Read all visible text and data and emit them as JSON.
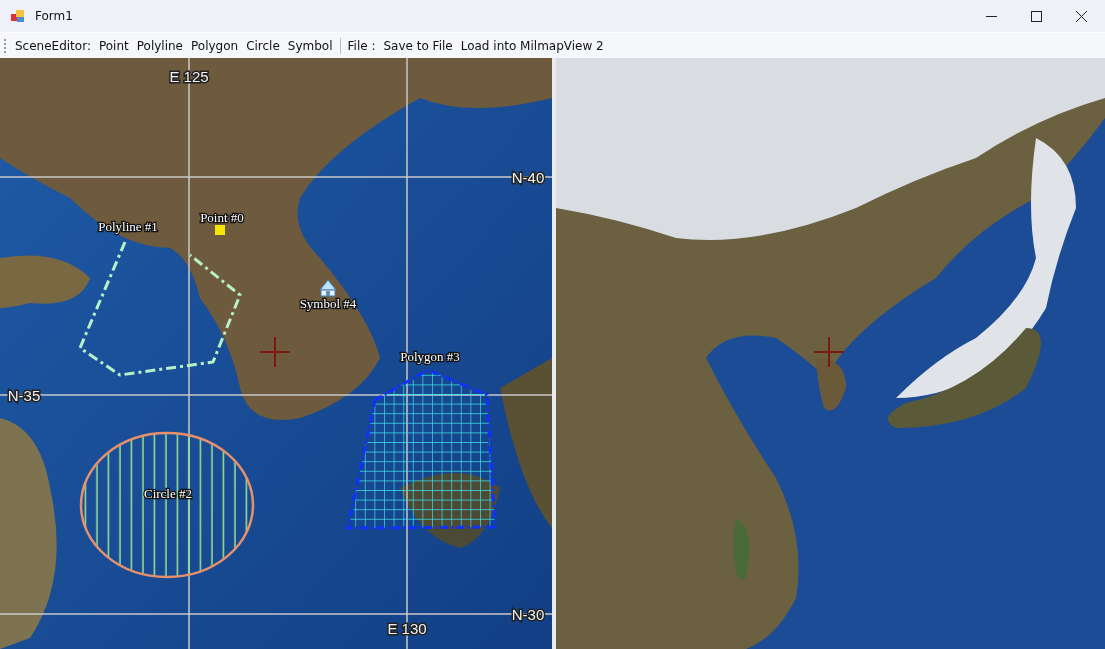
{
  "window": {
    "title": "Form1"
  },
  "toolbar": [
    {
      "kind": "label",
      "text": "SceneEditor:"
    },
    {
      "kind": "button",
      "text": "Point"
    },
    {
      "kind": "button",
      "text": "Polyline"
    },
    {
      "kind": "button",
      "text": "Polygon"
    },
    {
      "kind": "button",
      "text": "Circle"
    },
    {
      "kind": "button",
      "text": "Symbol"
    },
    {
      "kind": "separator"
    },
    {
      "kind": "label",
      "text": "File :"
    },
    {
      "kind": "button",
      "text": "Save to File"
    },
    {
      "kind": "button",
      "text": "Load into MilmapView 2"
    }
  ],
  "left_map": {
    "grid_labels": [
      {
        "text": "E 125"
      },
      {
        "text": "N-40"
      },
      {
        "text": "N-35"
      },
      {
        "text": "N-30"
      },
      {
        "text": "E 130"
      }
    ],
    "features": [
      {
        "kind": "point",
        "label": "Point #0"
      },
      {
        "kind": "polyline",
        "label": "Polyline #1"
      },
      {
        "kind": "circle",
        "label": "Circle #2"
      },
      {
        "kind": "polygon",
        "label": "Polygon #3"
      },
      {
        "kind": "symbol",
        "label": "Symbol #4"
      }
    ]
  }
}
